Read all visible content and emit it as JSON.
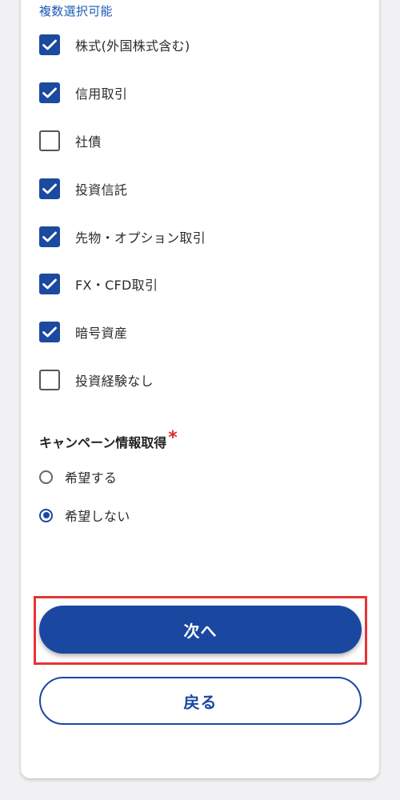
{
  "form": {
    "hint": "複数選択可能",
    "experience_options": [
      {
        "label": "株式(外国株式含む)",
        "checked": true
      },
      {
        "label": "信用取引",
        "checked": true
      },
      {
        "label": "社債",
        "checked": false
      },
      {
        "label": "投資信託",
        "checked": true
      },
      {
        "label": "先物・オプション取引",
        "checked": true
      },
      {
        "label": "FX・CFD取引",
        "checked": true
      },
      {
        "label": "暗号資産",
        "checked": true
      },
      {
        "label": "投資経験なし",
        "checked": false
      }
    ],
    "campaign": {
      "title": "キャンペーン情報取得",
      "required_mark": "*",
      "options": [
        {
          "label": "希望する",
          "selected": false
        },
        {
          "label": "希望しない",
          "selected": true
        }
      ]
    }
  },
  "actions": {
    "next_label": "次へ",
    "back_label": "戻る"
  },
  "colors": {
    "accent": "#1a48a0",
    "hint": "#1a5ab4",
    "required": "#d62b2b",
    "highlight": "#e53535"
  },
  "icons": {
    "checkbox_checked": "checkmark-icon"
  }
}
